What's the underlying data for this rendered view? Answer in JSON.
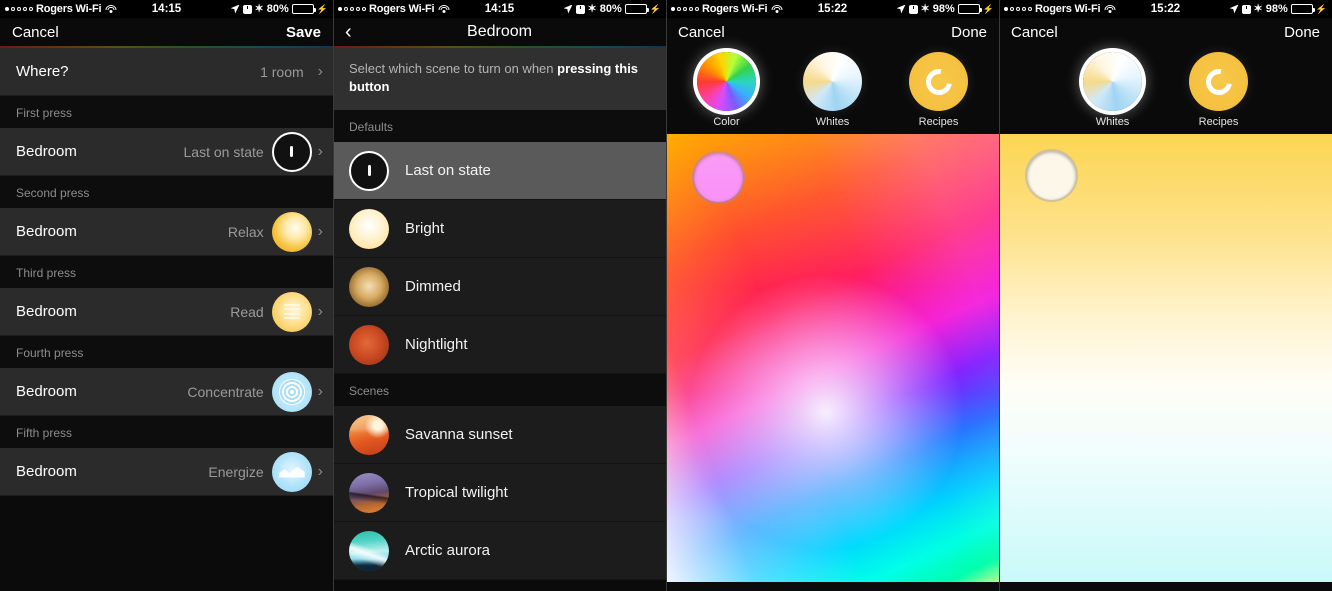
{
  "panels": [
    {
      "status": {
        "carrier": "Rogers Wi-Fi",
        "time": "14:15",
        "battery": "80%"
      },
      "nav": {
        "left": "Cancel",
        "right": "Save"
      },
      "where_row": {
        "title": "Where?",
        "value": "1 room"
      },
      "sections": [
        {
          "header": "First press",
          "row": {
            "title": "Bedroom",
            "value": "Last on state",
            "icon": "power-icon"
          }
        },
        {
          "header": "Second press",
          "row": {
            "title": "Bedroom",
            "value": "Relax",
            "icon": "relax-icon"
          }
        },
        {
          "header": "Third press",
          "row": {
            "title": "Bedroom",
            "value": "Read",
            "icon": "read-icon"
          }
        },
        {
          "header": "Fourth press",
          "row": {
            "title": "Bedroom",
            "value": "Concentrate",
            "icon": "concentrate-icon"
          }
        },
        {
          "header": "Fifth press",
          "row": {
            "title": "Bedroom",
            "value": "Energize",
            "icon": "energize-icon"
          }
        }
      ]
    },
    {
      "status": {
        "carrier": "Rogers Wi-Fi",
        "time": "14:15",
        "battery": "80%"
      },
      "nav": {
        "back": "‹",
        "title": "Bedroom"
      },
      "description": {
        "lead": "Select which scene to turn on when ",
        "bold": "pressing this button"
      },
      "groups": [
        {
          "header": "Defaults",
          "items": [
            {
              "label": "Last on state",
              "icon": "power-icon",
              "selected": true
            },
            {
              "label": "Bright",
              "icon": "bright-icon",
              "selected": false
            },
            {
              "label": "Dimmed",
              "icon": "dimmed-icon",
              "selected": false
            },
            {
              "label": "Nightlight",
              "icon": "nightlight-icon",
              "selected": false
            }
          ]
        },
        {
          "header": "Scenes",
          "items": [
            {
              "label": "Savanna sunset",
              "icon": "savanna-sunset-thumb",
              "selected": false
            },
            {
              "label": "Tropical twilight",
              "icon": "tropical-twilight-thumb",
              "selected": false
            },
            {
              "label": "Arctic aurora",
              "icon": "arctic-aurora-thumb",
              "selected": false
            }
          ]
        }
      ]
    },
    {
      "status": {
        "carrier": "Rogers Wi-Fi",
        "time": "15:22",
        "battery": "98%"
      },
      "nav": {
        "left": "Cancel",
        "right": "Done"
      },
      "modes": [
        {
          "label": "Color",
          "icon": "color-wheel-icon",
          "active": true
        },
        {
          "label": "Whites",
          "icon": "whites-wheel-icon",
          "active": false
        },
        {
          "label": "Recipes",
          "icon": "recipes-icon",
          "active": false
        }
      ],
      "gamut": {
        "type": "color",
        "handle_color": "#f77ef7"
      }
    },
    {
      "status": {
        "carrier": "Rogers Wi-Fi",
        "time": "15:22",
        "battery": "98%"
      },
      "nav": {
        "left": "Cancel",
        "right": "Done"
      },
      "modes": [
        {
          "label": "Whites",
          "icon": "whites-wheel-icon",
          "active": true
        },
        {
          "label": "Recipes",
          "icon": "recipes-icon",
          "active": false
        }
      ],
      "gamut": {
        "type": "whites",
        "handle_color": "#fcf7e8"
      }
    }
  ],
  "colors": {
    "accent_green": "#4cd964",
    "selected_row": "#5a5a5a",
    "row_bg": "#2b2b2b",
    "section_header_text": "#8d8d8d"
  }
}
